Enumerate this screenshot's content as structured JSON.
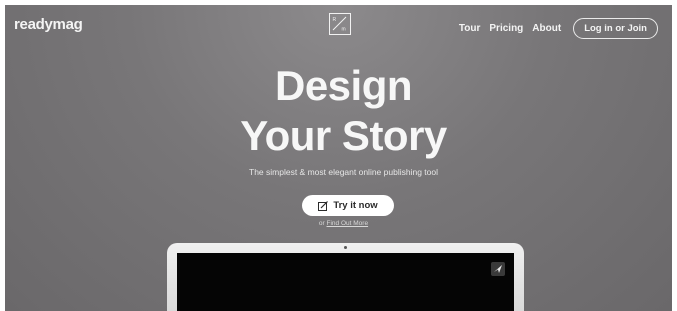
{
  "header": {
    "logo_text": "readymag",
    "center_icon": "readymag-mark-icon",
    "nav": {
      "tour": "Tour",
      "pricing": "Pricing",
      "about": "About",
      "login": "Log in or Join"
    }
  },
  "hero": {
    "title_line1": "Design",
    "title_line2": "Your Story",
    "subtitle": "The simplest & most elegant online publishing tool",
    "cta_label": "Try it now",
    "cta_icon": "edit-icon",
    "find_prefix": "or",
    "find_link": "Find Out More"
  },
  "preview": {
    "device": "laptop",
    "screen_icon": "send-icon"
  },
  "colors": {
    "background": "#787678",
    "text": "#f4f4f4",
    "button_bg": "#ffffff",
    "screen": "#050505"
  }
}
